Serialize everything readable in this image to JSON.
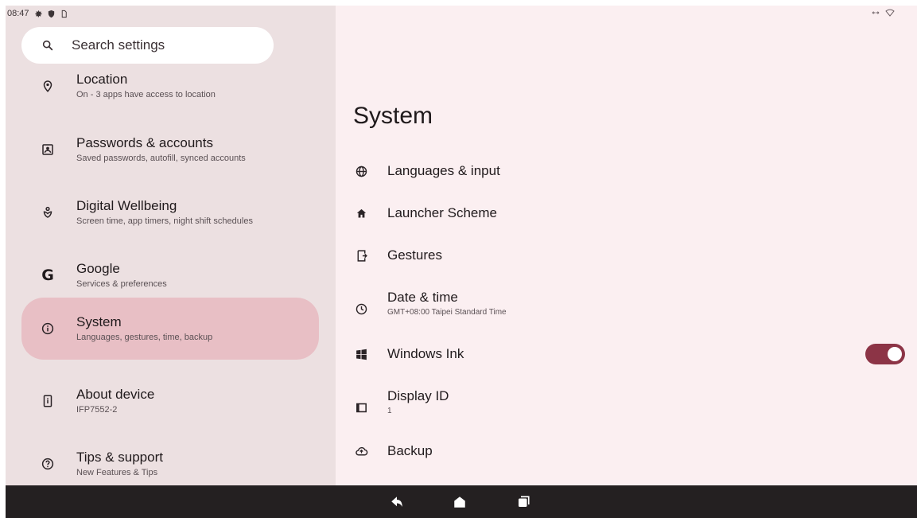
{
  "status_bar": {
    "time": "08:47",
    "left_icons": [
      "gear-icon",
      "shield-icon",
      "sim-icon"
    ],
    "right_icons": [
      "data-arrows-icon",
      "wifi-icon"
    ]
  },
  "search": {
    "placeholder": "Search settings",
    "icon": "search-icon"
  },
  "sidebar": {
    "items": [
      {
        "icon": "location-pin-icon",
        "title": "Location",
        "subtitle": "On - 3 apps have access to location"
      },
      {
        "icon": "account-box-icon",
        "title": "Passwords & accounts",
        "subtitle": "Saved passwords, autofill, synced accounts"
      },
      {
        "icon": "wellbeing-icon",
        "title": "Digital Wellbeing",
        "subtitle": "Screen time, app timers, night shift schedules"
      },
      {
        "icon": "google-g-icon",
        "title": "Google",
        "subtitle": "Services & preferences",
        "glyph": "G"
      },
      {
        "icon": "info-icon",
        "title": "System",
        "subtitle": "Languages, gestures, time, backup",
        "selected": true
      },
      {
        "icon": "device-icon",
        "title": "About device",
        "subtitle": "IFP7552-2"
      },
      {
        "icon": "help-icon",
        "title": "Tips & support",
        "subtitle": "New Features & Tips"
      }
    ]
  },
  "main": {
    "title": "System",
    "items": [
      {
        "icon": "globe-icon",
        "title": "Languages & input"
      },
      {
        "icon": "home-icon",
        "title": "Launcher Scheme"
      },
      {
        "icon": "gestures-icon",
        "title": "Gestures"
      },
      {
        "icon": "clock-icon",
        "title": "Date & time",
        "subtitle": "GMT+08:00 Taipei Standard Time"
      },
      {
        "icon": "windows-icon",
        "title": "Windows Ink",
        "toggle": true
      },
      {
        "icon": "display-icon",
        "title": "Display ID",
        "subtitle": "1"
      },
      {
        "icon": "cloud-backup-icon",
        "title": "Backup"
      }
    ]
  },
  "navbar": {
    "buttons": [
      "back-icon",
      "home-nav-icon",
      "recents-icon"
    ]
  },
  "colors": {
    "sidebar_bg": "#ece0e1",
    "content_bg": "#fbeff1",
    "selected_bg": "#e8bfc5",
    "toggle_on": "#8c3446",
    "navbar_bg": "#242021"
  }
}
